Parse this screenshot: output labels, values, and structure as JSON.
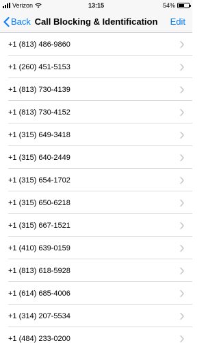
{
  "status_bar": {
    "carrier": "Verizon",
    "time": "13:15",
    "battery_percent": "54%",
    "battery_level": 0.54
  },
  "nav": {
    "back_label": "Back",
    "title": "Call Blocking & Identification",
    "edit_label": "Edit",
    "accent_color": "#007aff"
  },
  "blocked_numbers": [
    "+1 (813) 486-9860",
    "+1 (260) 451-5153",
    "+1 (813) 730-4139",
    "+1 (813) 730-4152",
    "+1 (315) 649-3418",
    "+1 (315) 640-2449",
    "+1 (315) 654-1702",
    "+1 (315) 650-6218",
    "+1 (315) 667-1521",
    "+1 (410) 639-0159",
    "+1 (813) 618-5928",
    "+1 (614) 685-4006",
    "+1 (314) 207-5534",
    "+1 (484) 233-0200"
  ]
}
